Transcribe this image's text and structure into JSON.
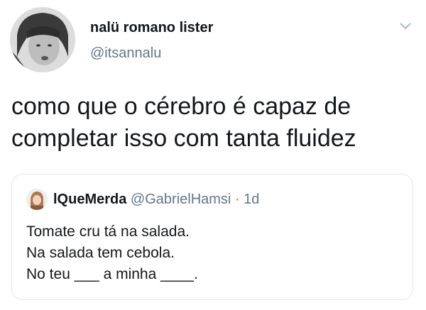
{
  "tweet": {
    "display_name": "nalü romano lister",
    "handle": "@itsannalu",
    "text": "como que o cérebro é capaz de completar isso com tanta fluidez",
    "menu_icon": "chevron-down-icon"
  },
  "quoted_tweet": {
    "display_name": "lQueMerda",
    "handle": "@GabrielHamsi",
    "separator": "·",
    "time": "1d",
    "lines": [
      "Tomate cru tá na salada.",
      "Na salada tem cebola.",
      "No teu ___ a minha ____."
    ]
  },
  "colors": {
    "text": "#14171a",
    "secondary": "#657786",
    "border": "#e1e8ed"
  }
}
